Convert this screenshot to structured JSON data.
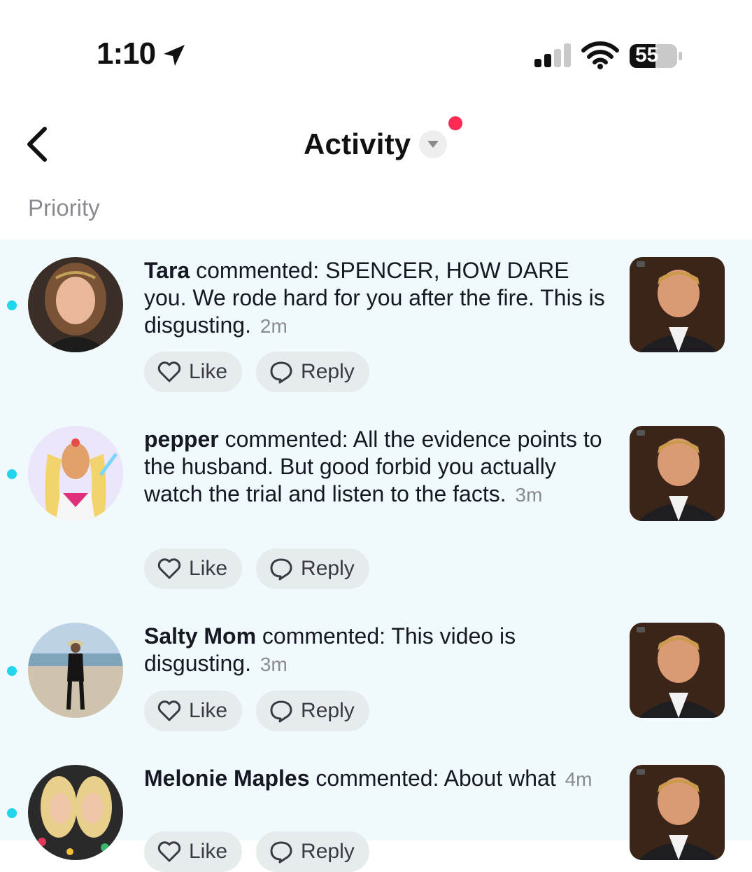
{
  "status_bar": {
    "time": "1:10",
    "battery": "55",
    "icons": [
      "location-arrow-icon",
      "cellular-signal-icon",
      "wifi-icon",
      "battery-icon"
    ]
  },
  "header": {
    "title": "Activity",
    "has_notification_dot": true,
    "icons": [
      "back-chevron-icon",
      "dropdown-triangle-icon"
    ]
  },
  "section": {
    "label": "Priority"
  },
  "colors": {
    "unread_dot": "#20d5ec",
    "notification_dot": "#fe2c55",
    "list_background": "#f0f9fb",
    "pill_background": "#e6ebee"
  },
  "activities": [
    {
      "user": "Tara",
      "action": " commented: ",
      "text": "SPENCER, HOW DARE you. We rode hard for you after the fire. This is disgusting.",
      "time": "2m",
      "like_label": "Like",
      "reply_label": "Reply"
    },
    {
      "user": "pepper",
      "action": " commented: ",
      "text": "All the evidence points to the husband. But good forbid you actually watch the trial and listen to the facts.",
      "time": "3m",
      "like_label": "Like",
      "reply_label": "Reply"
    },
    {
      "user": "Salty Mom",
      "action": " commented: ",
      "text": "This video is disgusting.",
      "time": "3m",
      "like_label": "Like",
      "reply_label": "Reply"
    },
    {
      "user": "Melonie Maples",
      "action": " commented: ",
      "text": "About what",
      "time": "4m",
      "like_label": "Like",
      "reply_label": "Reply"
    }
  ]
}
